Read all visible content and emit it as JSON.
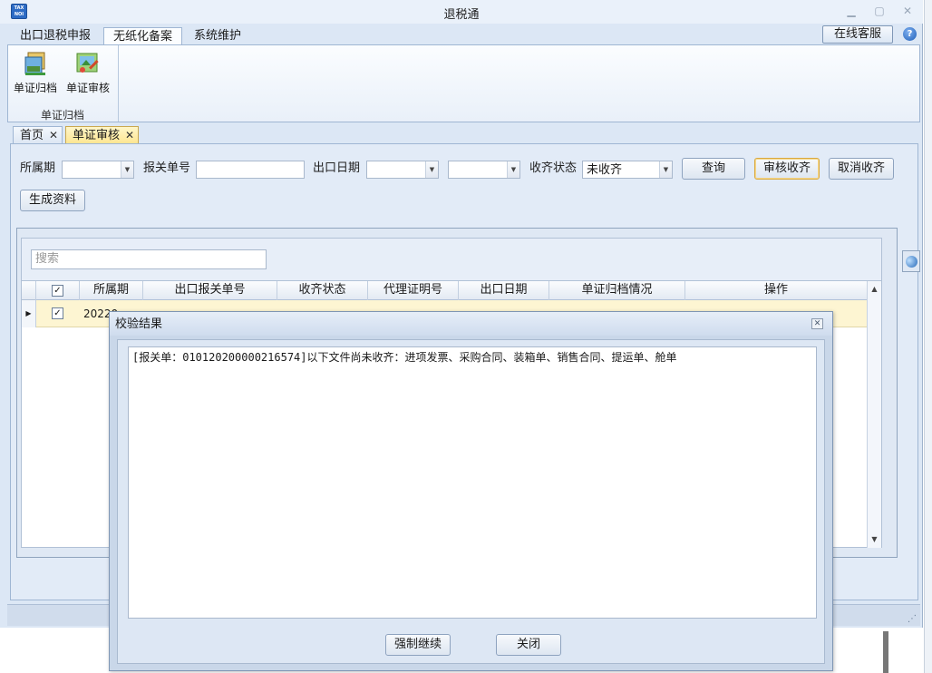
{
  "app": {
    "title": "退税通",
    "icon_text_top": "TAX",
    "icon_text_bottom": "NOI"
  },
  "menu": {
    "tabs": [
      {
        "label": "出口退税申报",
        "active": false
      },
      {
        "label": "无纸化备案",
        "active": true
      },
      {
        "label": "系统维护",
        "active": false
      }
    ],
    "online_service": "在线客服"
  },
  "ribbon": {
    "buttons": [
      {
        "label": "单证归档",
        "icon": "archive-icon"
      },
      {
        "label": "单证审核",
        "icon": "audit-icon"
      }
    ],
    "group_label": "单证归档"
  },
  "doc_tabs": [
    {
      "label": "首页",
      "active": false
    },
    {
      "label": "单证审核",
      "active": true
    }
  ],
  "filters": {
    "period_label": "所属期",
    "period_value": "",
    "customs_no_label": "报关单号",
    "customs_no_value": "",
    "export_date_label": "出口日期",
    "export_date_from": "",
    "export_date_to": "",
    "collect_status_label": "收齐状态",
    "collect_status_value": "未收齐"
  },
  "actions": {
    "query": "查询",
    "audit_collect": "审核收齐",
    "cancel_collect": "取消收齐",
    "generate": "生成资料"
  },
  "grid": {
    "search_placeholder": "搜索",
    "columns": [
      "所属期",
      "出口报关单号",
      "收齐状态",
      "代理证明号",
      "出口日期",
      "单证归档情况",
      "操作"
    ],
    "rows": [
      {
        "period": "20220",
        "checked": true
      }
    ]
  },
  "dialog": {
    "title": "校验结果",
    "message": "[报关单：010120200000216574]以下文件尚未收齐：进项发票、采购合同、装箱单、销售合同、提运单、舱单",
    "force_continue": "强制继续",
    "close": "关闭"
  },
  "colors": {
    "window_bg": "#dce7f5",
    "active_doc_tab": "#fde58f",
    "selected_row": "#fdf5d2"
  }
}
